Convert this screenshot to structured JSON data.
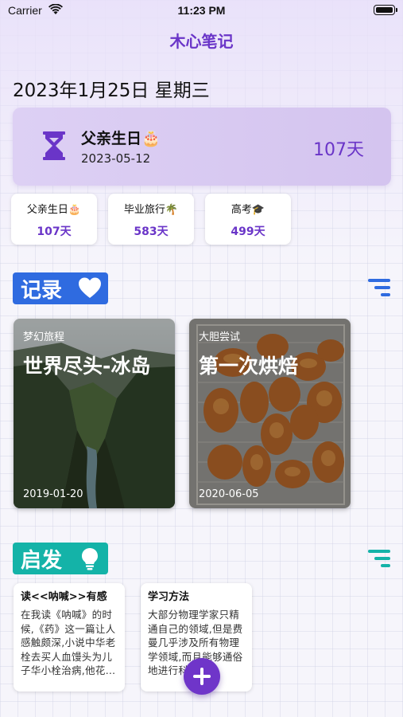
{
  "status": {
    "carrier": "Carrier",
    "time": "11:23 PM"
  },
  "app": {
    "title": "木心笔记"
  },
  "today": {
    "date": "2023年1月25日 星期三"
  },
  "countdown": {
    "name": "父亲生日🎂",
    "date": "2023-05-12",
    "days": "107天"
  },
  "mini_countdowns": [
    {
      "name": "父亲生日🎂",
      "days": "107天"
    },
    {
      "name": "毕业旅行🌴",
      "days": "583天"
    },
    {
      "name": "高考🎓",
      "days": "499天"
    }
  ],
  "records": {
    "label": "记录",
    "accent": "#2f6be0",
    "icon": "heart-icon",
    "cards": [
      {
        "category": "梦幻旅程",
        "title": "世界尽头-冰岛",
        "date": "2019-01-20"
      },
      {
        "category": "大胆尝试",
        "title": "第一次烘焙",
        "date": "2020-06-05"
      }
    ]
  },
  "inspiration": {
    "label": "启发",
    "accent": "#14b3a8",
    "icon": "lightbulb-icon",
    "cards": [
      {
        "title": "读<<呐喊>>有感",
        "body": "在我读《呐喊》的时候,《药》这一篇让人感触颇深,小说中华老栓去买人血馒头为儿子华小栓治病,他花…"
      },
      {
        "title": "学习方法",
        "body": "大部分物理学家只精通自己的领域,但是费曼几乎涉及所有物理学领域,而且能够通俗地进行科普…"
      }
    ]
  },
  "colors": {
    "purple": "#6a35c8",
    "fab": "#6f35c9"
  }
}
